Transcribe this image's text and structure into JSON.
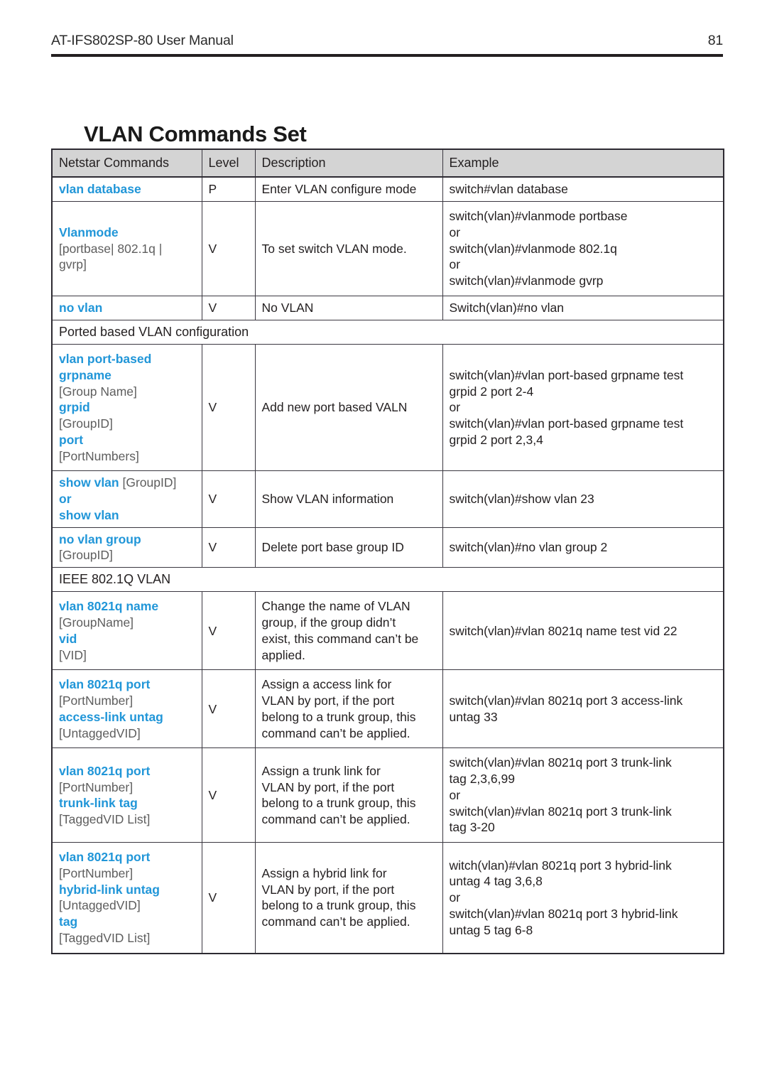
{
  "page": {
    "header_left": "AT-IFS802SP-80 User Manual",
    "header_right": "81",
    "title": "VLAN Commands Set"
  },
  "colors": {
    "command_blue": "#2196d8",
    "param_gray": "#5e5e5e",
    "header_fill": "#d4d4d4",
    "border": "#2d2a32",
    "text": "#231f20"
  },
  "table": {
    "columns": [
      "Netstar Commands",
      "Level",
      "Description",
      "Example"
    ],
    "rows": [
      {
        "kind": "data",
        "command_lines": [
          {
            "text": "vlan database",
            "style": "kw"
          }
        ],
        "level": "P",
        "description_lines": [
          "Enter VLAN configure mode"
        ],
        "example_lines": [
          "switch#vlan database"
        ]
      },
      {
        "kind": "data",
        "command_lines": [
          {
            "text": "Vlanmode",
            "style": "kw"
          },
          {
            "text": "[portbase| 802.1q |",
            "style": "param"
          },
          {
            "text": "gvrp]",
            "style": "param"
          }
        ],
        "level": "V",
        "description_lines": [
          "To set switch VLAN mode."
        ],
        "example_lines": [
          "switch(vlan)#vlanmode portbase",
          "or",
          "switch(vlan)#vlanmode 802.1q",
          "or",
          "switch(vlan)#vlanmode gvrp"
        ]
      },
      {
        "kind": "data",
        "command_lines": [
          {
            "text": "no vlan",
            "style": "kw"
          }
        ],
        "level": "V",
        "description_lines": [
          "No VLAN"
        ],
        "example_lines": [
          "Switch(vlan)#no vlan"
        ]
      },
      {
        "kind": "section",
        "section_label": "Ported based VLAN configuration"
      },
      {
        "kind": "data",
        "command_lines": [
          {
            "text": "vlan port-based",
            "style": "kw"
          },
          {
            "text": "grpname",
            "style": "kw"
          },
          {
            "text": "[Group Name]",
            "style": "param"
          },
          {
            "text": "grpid",
            "style": "kw"
          },
          {
            "text": "[GroupID]",
            "style": "param"
          },
          {
            "text": "port",
            "style": "kw"
          },
          {
            "text": "[PortNumbers]",
            "style": "param"
          }
        ],
        "level": "V",
        "description_lines": [
          "Add new port based VALN"
        ],
        "example_lines": [
          "switch(vlan)#vlan port-based grpname test",
          "grpid 2 port 2-4",
          "or",
          "switch(vlan)#vlan port-based grpname test",
          "grpid 2 port 2,3,4"
        ]
      },
      {
        "kind": "data",
        "command_lines": [
          {
            "text": "show vlan ",
            "style": "kw",
            "suffix": "[GroupID]",
            "suffix_style": "param"
          },
          {
            "text": "or",
            "style": "kw"
          },
          {
            "text": "show vlan",
            "style": "kw"
          }
        ],
        "level": "V",
        "description_lines": [
          "Show VLAN information"
        ],
        "example_lines": [
          "switch(vlan)#show vlan 23"
        ]
      },
      {
        "kind": "data",
        "command_lines": [
          {
            "text": "no vlan group",
            "style": "kw"
          },
          {
            "text": "[GroupID]",
            "style": "param"
          }
        ],
        "level": "V",
        "description_lines": [
          "Delete port base group ID"
        ],
        "example_lines": [
          "switch(vlan)#no vlan group 2"
        ]
      },
      {
        "kind": "section",
        "section_label": "IEEE 802.1Q VLAN"
      },
      {
        "kind": "data",
        "command_lines": [
          {
            "text": "vlan 8021q name",
            "style": "kw"
          },
          {
            "text": "[GroupName]",
            "style": "param"
          },
          {
            "text": "vid",
            "style": "kw"
          },
          {
            "text": "[VID]",
            "style": "param"
          }
        ],
        "level": "V",
        "description_lines": [
          "Change the name of VLAN",
          "group, if the group didn’t",
          "exist, this command can’t be",
          "applied."
        ],
        "example_lines": [
          "switch(vlan)#vlan 8021q name test vid 22"
        ]
      },
      {
        "kind": "data",
        "command_lines": [
          {
            "text": "vlan 8021q port",
            "style": "kw"
          },
          {
            "text": "[PortNumber]",
            "style": "param"
          },
          {
            "text": "access-link untag",
            "style": "kw"
          },
          {
            "text": "[UntaggedVID]",
            "style": "param"
          }
        ],
        "level": "V",
        "description_lines": [
          "Assign a access link for",
          "VLAN by port, if the port",
          "belong to a trunk group, this",
          "command can’t be applied."
        ],
        "example_lines": [
          "switch(vlan)#vlan 8021q port 3 access-link",
          "untag 33"
        ]
      },
      {
        "kind": "data",
        "command_lines": [
          {
            "text": "vlan 8021q port",
            "style": "kw"
          },
          {
            "text": "[PortNumber]",
            "style": "param"
          },
          {
            "text": "trunk-link tag",
            "style": "kw"
          },
          {
            "text": "[TaggedVID List]",
            "style": "param"
          }
        ],
        "level": "V",
        "description_lines": [
          "Assign a trunk link for",
          "VLAN by port, if the port",
          "belong to a trunk group, this",
          "command can’t be applied."
        ],
        "example_lines": [
          "switch(vlan)#vlan 8021q port 3 trunk-link",
          "tag 2,3,6,99",
          "or",
          "switch(vlan)#vlan 8021q port 3 trunk-link",
          "tag 3-20"
        ]
      },
      {
        "kind": "data",
        "command_lines": [
          {
            "text": "vlan 8021q port",
            "style": "kw"
          },
          {
            "text": "[PortNumber]",
            "style": "param"
          },
          {
            "text": "hybrid-link untag",
            "style": "kw"
          },
          {
            "text": "[UntaggedVID]",
            "style": "param"
          },
          {
            "text": "tag",
            "style": "kw"
          },
          {
            "text": "[TaggedVID List]",
            "style": "param"
          }
        ],
        "level": "V",
        "description_lines": [
          "Assign a hybrid link for",
          "VLAN by port, if the port",
          "belong to a trunk group, this",
          "command can’t be applied."
        ],
        "example_lines": [
          "witch(vlan)#vlan 8021q port 3 hybrid-link",
          "untag 4 tag 3,6,8",
          "or",
          "switch(vlan)#vlan 8021q port 3 hybrid-link",
          "untag 5 tag 6-8"
        ]
      }
    ]
  }
}
